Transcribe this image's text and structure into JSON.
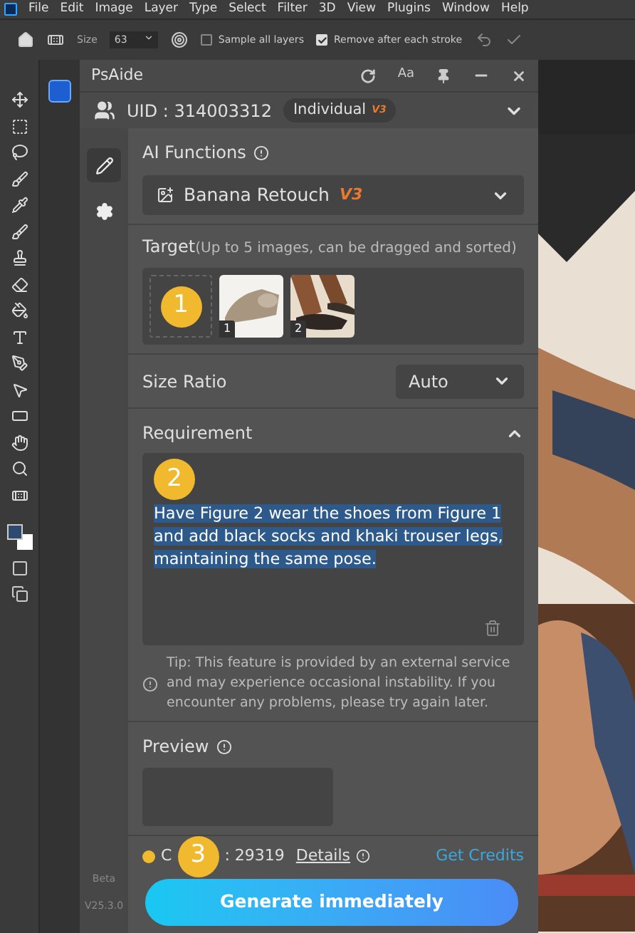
{
  "menu_bar": [
    "File",
    "Edit",
    "Image",
    "Layer",
    "Type",
    "Select",
    "Filter",
    "3D",
    "View",
    "Plugins",
    "Window",
    "Help"
  ],
  "options_bar": {
    "size_label": "Size",
    "size_value": "63",
    "checkboxes": [
      {
        "label": "Sample all layers",
        "checked": false
      },
      {
        "label": "Remove after each stroke",
        "checked": true
      }
    ]
  },
  "panel": {
    "title": "PsAide",
    "font_button": "Aa",
    "user": {
      "uid": "UID : 314003312",
      "plan": "Individual",
      "plan_version": "V3"
    },
    "side_tabs": [
      {
        "kind": "edit",
        "selected": true
      },
      {
        "kind": "settings",
        "selected": false
      }
    ],
    "version": {
      "label": "Beta",
      "number": "V25.3.0"
    },
    "ai_functions": {
      "label": "AI Functions",
      "value": "Banana Retouch",
      "version": "V3"
    },
    "target": {
      "label": "Target",
      "hint": "(Up to 5 images, can be dragged and sorted)",
      "images": [
        {
          "number": "1"
        },
        {
          "number": "2"
        }
      ]
    },
    "size_ratio": {
      "label": "Size Ratio",
      "value": "Auto"
    },
    "requirement": {
      "label": "Requirement",
      "expanded": true,
      "text": "Have Figure 2 wear the shoes from Figure 1 and add black socks and khaki trouser legs, maintaining the same pose.",
      "text_selected": true
    },
    "tip": "Tip: This feature is provided by an external service and may experience occasional instability. If you encounter any problems, please try again later.",
    "preview": {
      "label": "Preview"
    },
    "credits": {
      "prefix": "C",
      "value": ": 29319",
      "details": "Details",
      "get_credits": "Get Credits"
    },
    "generate_button": "Generate immediately"
  },
  "annotations": [
    {
      "number": "1"
    },
    {
      "number": "2"
    },
    {
      "number": "3"
    }
  ]
}
